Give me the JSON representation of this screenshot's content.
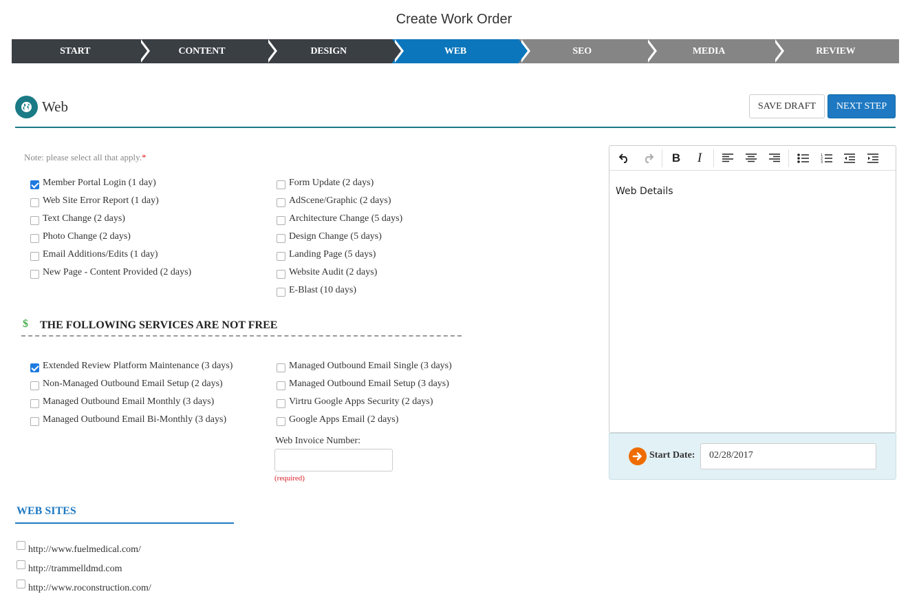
{
  "page": {
    "title": "Create Work Order"
  },
  "steps": [
    {
      "label": "START",
      "state": "done"
    },
    {
      "label": "CONTENT",
      "state": "done"
    },
    {
      "label": "DESIGN",
      "state": "done"
    },
    {
      "label": "WEB",
      "state": "active"
    },
    {
      "label": "SEO",
      "state": "todo"
    },
    {
      "label": "MEDIA",
      "state": "todo"
    },
    {
      "label": "REVIEW",
      "state": "todo"
    }
  ],
  "section": {
    "title": "Web",
    "icon": "globe-icon",
    "save_draft": "SAVE DRAFT",
    "next_step": "NEXT STEP",
    "note": "Note: please select all that apply.",
    "note_required": "*"
  },
  "free_services": {
    "left": [
      {
        "label": "Member Portal Login (1 day)",
        "checked": true
      },
      {
        "label": "Web Site Error Report (1 day)",
        "checked": false
      },
      {
        "label": "Text Change (2 days)",
        "checked": false
      },
      {
        "label": "Photo Change (2 days)",
        "checked": false
      },
      {
        "label": "Email Additions/Edits (1 day)",
        "checked": false
      },
      {
        "label": "New Page - Content Provided (2 days)",
        "checked": false
      }
    ],
    "right": [
      {
        "label": "Form Update (2 days)",
        "checked": false
      },
      {
        "label": "AdScene/Graphic (2 days)",
        "checked": false
      },
      {
        "label": "Architecture Change (5 days)",
        "checked": false
      },
      {
        "label": "Design Change (5 days)",
        "checked": false
      },
      {
        "label": "Landing Page (5 days)",
        "checked": false
      },
      {
        "label": "Website Audit (2 days)",
        "checked": false
      },
      {
        "label": "E-Blast (10 days)",
        "checked": false
      }
    ]
  },
  "paid": {
    "icon_text": "$",
    "title": "THE FOLLOWING SERVICES ARE NOT FREE",
    "left": [
      {
        "label": "Extended Review Platform Maintenance (3 days)",
        "checked": true
      },
      {
        "label": "Non-Managed Outbound Email Setup (2 days)",
        "checked": false
      },
      {
        "label": "Managed Outbound Email Monthly (3 days)",
        "checked": false
      },
      {
        "label": "Managed Outbound Email Bi-Monthly (3 days)",
        "checked": false
      }
    ],
    "right": [
      {
        "label": "Managed Outbound Email Single (3 days)",
        "checked": false
      },
      {
        "label": "Managed Outbound Email Setup (3 days)",
        "checked": false
      },
      {
        "label": "Virtru Google Apps Security (2 days)",
        "checked": false
      },
      {
        "label": "Google Apps Email (2 days)",
        "checked": false
      }
    ],
    "invoice_label": "Web Invoice Number:",
    "invoice_value": "",
    "invoice_required": "(required)"
  },
  "websites": {
    "title": "WEB SITES",
    "items": [
      {
        "label": "http://www.fuelmedical.com/",
        "checked": false
      },
      {
        "label": "http://trammelldmd.com",
        "checked": false
      },
      {
        "label": "http://www.roconstruction.com/",
        "checked": false
      }
    ]
  },
  "editor": {
    "content": "Web Details",
    "tools": [
      "undo-icon",
      "redo-icon",
      "bold-icon",
      "italic-icon",
      "align-left-icon",
      "align-center-icon",
      "align-right-icon",
      "bullet-list-icon",
      "numbered-list-icon",
      "outdent-icon",
      "indent-icon"
    ]
  },
  "start_date": {
    "label": "Start Date:",
    "value": "02/28/2017"
  },
  "colors": {
    "teal": "#1a7a85",
    "blue": "#1f79c2",
    "active_step": "#0b76bb",
    "dark_step": "#3a3f44",
    "grey_step": "#858585",
    "orange": "#ef6c00"
  }
}
